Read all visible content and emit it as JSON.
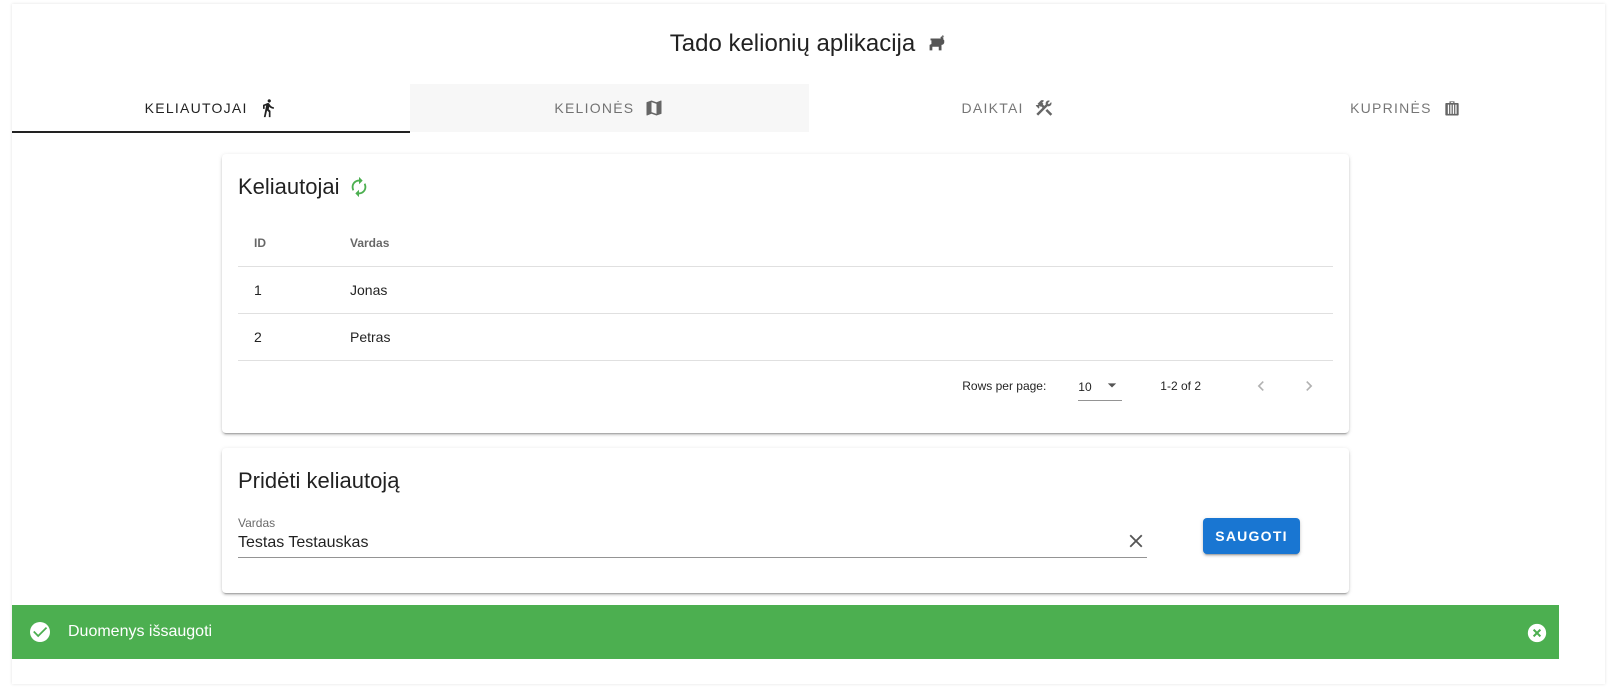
{
  "app": {
    "title": "Tado kelionių aplikacija",
    "title_icon": "dog-icon"
  },
  "tabs": [
    {
      "label": "Keliautojai",
      "icon": "walk-icon",
      "active": true
    },
    {
      "label": "Kelionės",
      "icon": "map-icon",
      "active": false
    },
    {
      "label": "Daiktai",
      "icon": "tools-icon",
      "active": false
    },
    {
      "label": "Kuprinės",
      "icon": "bag-icon",
      "active": false
    }
  ],
  "travelers_card": {
    "title": "Keliautojai",
    "refresh_icon": "refresh-icon",
    "columns": [
      "ID",
      "Vardas"
    ],
    "rows": [
      {
        "id": "1",
        "name": "Jonas"
      },
      {
        "id": "2",
        "name": "Petras"
      }
    ],
    "pagination": {
      "rows_per_page_label": "Rows per page:",
      "rows_per_page": "10",
      "range": "1-2 of 2"
    }
  },
  "add_card": {
    "title": "Pridėti keliautoją",
    "field_label": "Vardas",
    "field_value": "Testas Testauskas",
    "save_label": "Saugoti"
  },
  "snackbar": {
    "message": "Duomenys išsaugoti"
  },
  "colors": {
    "primary": "#1976d2",
    "success": "#4caf50",
    "refresh": "#4caf50"
  }
}
